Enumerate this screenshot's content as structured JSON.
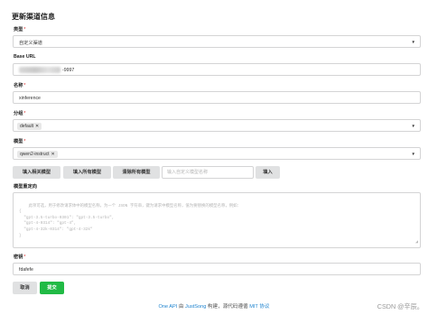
{
  "form": {
    "title": "更新渠道信息",
    "type": {
      "label": "类型",
      "required": "*",
      "value": "自定义渠道"
    },
    "base_url": {
      "label": "Base URL",
      "value": "-9997"
    },
    "name": {
      "label": "名称",
      "required": "*",
      "value": "xinference"
    },
    "group": {
      "label": "分组",
      "required": "*",
      "tags": [
        "default"
      ]
    },
    "models": {
      "label": "模型",
      "required": "*",
      "tags": [
        "qwen2-instruct"
      ]
    },
    "buttons": {
      "fill_related": "填入相关模型",
      "fill_all": "填入所有模型",
      "clear_all": "清除所有模型",
      "custom_placeholder": "输入自定义模型名称",
      "fill": "填入"
    },
    "mapping": {
      "label": "模型重定向",
      "placeholder": "此项可选，用于修改请求体中的模型名称，为一个 JSON 字符串，键为请求中模型名称，值为要替换的模型名称，例如：\n{\n  \"gpt-3.5-turbo-0301\": \"gpt-3.5-turbo\",\n  \"gpt-4-0314\": \"gpt-4\",\n  \"gpt-4-32k-0314\": \"gpt-4-32k\"\n}"
    },
    "key": {
      "label": "密钥",
      "required": "*",
      "value": "fdafefe"
    },
    "cancel": "取消",
    "submit": "提交"
  },
  "footer": {
    "one_api": "One API",
    "by": " 由 ",
    "author": "JustSong",
    "middle": " 构建，源代码遵循 ",
    "license": "MIT 协议"
  },
  "watermark": "CSDN @辛辰。",
  "icons": {
    "dropdown": "caret-down-icon",
    "remove": "close-icon"
  }
}
